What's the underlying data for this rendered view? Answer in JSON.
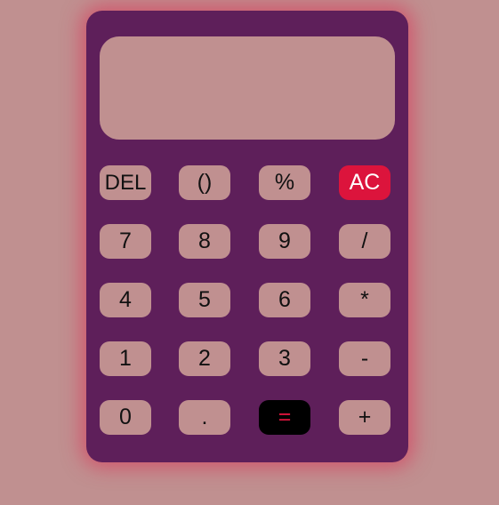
{
  "calculator": {
    "display": {
      "value": ""
    },
    "keys": {
      "del": "DEL",
      "paren": "()",
      "percent": "%",
      "ac": "AC",
      "seven": "7",
      "eight": "8",
      "nine": "9",
      "divide": "/",
      "four": "4",
      "five": "5",
      "six": "6",
      "multiply": "*",
      "one": "1",
      "two": "2",
      "three": "3",
      "minus": "-",
      "zero": "0",
      "dot": ".",
      "equals": "=",
      "plus": "+"
    }
  },
  "colors": {
    "page_background": "#c09090",
    "calculator_body": "#5e1f5a",
    "key_background": "#c09090",
    "ac_key": "#dc143c",
    "equals_key_background": "#000000",
    "equals_key_text": "#dc143c",
    "glow": "#dc2850"
  }
}
